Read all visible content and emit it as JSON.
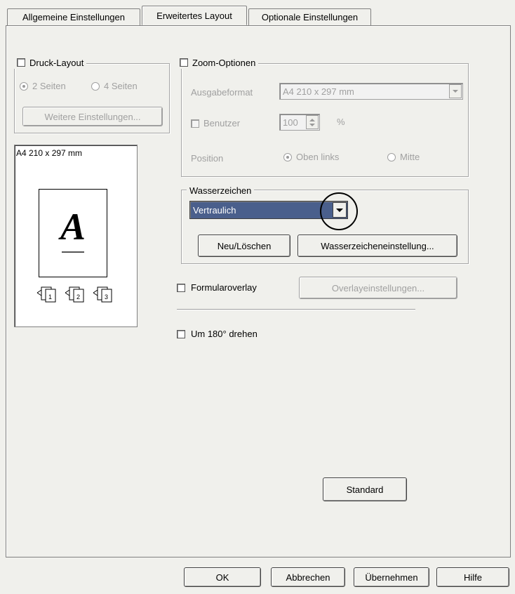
{
  "tabs": [
    {
      "label": "Allgemeine Einstellungen"
    },
    {
      "label": "Erweitertes Layout"
    },
    {
      "label": "Optionale Einstellungen"
    }
  ],
  "print_layout": {
    "label": "Druck-Layout",
    "radio_2": "2 Seiten",
    "radio_4": "4 Seiten",
    "more_button": "Weitere Einstellungen..."
  },
  "preview": {
    "paper_label": "A4 210 x 297 mm",
    "letter": "A"
  },
  "zoom": {
    "label": "Zoom-Optionen",
    "output_label": "Ausgabeformat",
    "output_value": "A4 210 x 297 mm",
    "user_label": "Benutzer",
    "user_value": "100",
    "percent": "%",
    "position_label": "Position",
    "pos_top_left": "Oben links",
    "pos_center": "Mitte"
  },
  "watermark": {
    "label": "Wasserzeichen",
    "selected": "Vertraulich",
    "new_delete": "Neu/Löschen",
    "settings": "Wasserzeicheneinstellung..."
  },
  "form_overlay": {
    "label": "Formularoverlay",
    "settings": "Overlayeinstellungen..."
  },
  "rotate": {
    "label": "Um 180° drehen"
  },
  "standard_button": "Standard",
  "footer": {
    "ok": "OK",
    "cancel": "Abbrechen",
    "apply": "Übernehmen",
    "help": "Hilfe"
  },
  "colors": {
    "selection": "#4a5f8c",
    "highlight_circle": "#000000"
  }
}
